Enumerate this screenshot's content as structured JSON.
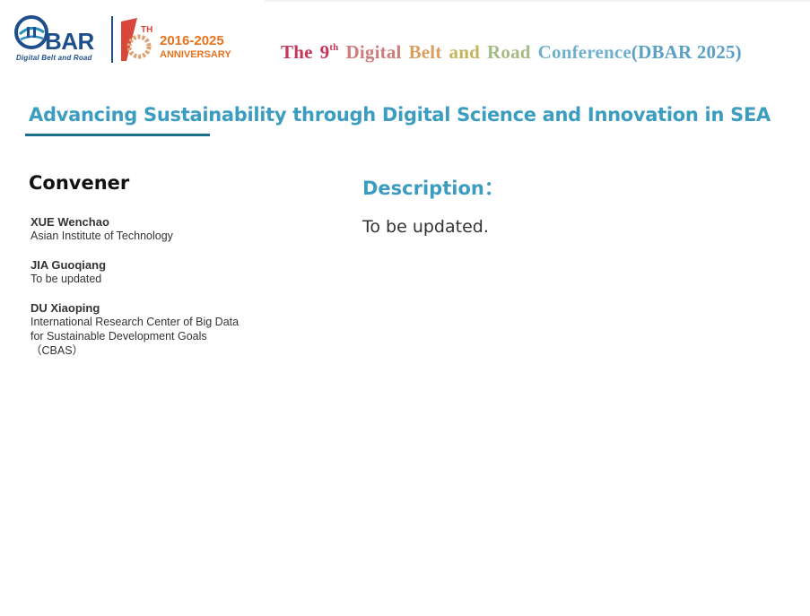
{
  "header": {
    "logo_word": "BAR",
    "logo_tagline": "Digital Belt and Road",
    "anniversary_years": "2016-2025",
    "anniversary_label": "ANNIVERSARY",
    "anniversary_sup": "TH",
    "conference_title": {
      "the": "The",
      "num": "9",
      "sup": "th",
      "digital": "Digital",
      "belt": "Belt",
      "and": "and",
      "road": "Road",
      "conference": "Conference",
      "acronym": "(DBAR 2025)"
    },
    "colors": {
      "the": "#c8365a",
      "num": "#c8365a",
      "digital": "#cf7d7a",
      "belt": "#d9a060",
      "and": "#c4b45c",
      "road": "#a4bc84",
      "conference": "#6fb0cc",
      "acronym": "#5b9fc5"
    }
  },
  "session": {
    "title": "Advancing Sustainability through Digital Science and Innovation in SEA"
  },
  "conveners": {
    "heading": "Convener",
    "people": [
      {
        "name": "XUE Wenchao",
        "affiliation": "Asian Institute of Technology"
      },
      {
        "name": "JIA Guoqiang",
        "affiliation": "To be updated"
      },
      {
        "name": "DU Xiaoping",
        "affiliation": "International Research Center of Big Data\nfor Sustainable Development Goals\n（CBAS）"
      }
    ]
  },
  "description": {
    "heading": "Description：",
    "text": "To be updated."
  }
}
